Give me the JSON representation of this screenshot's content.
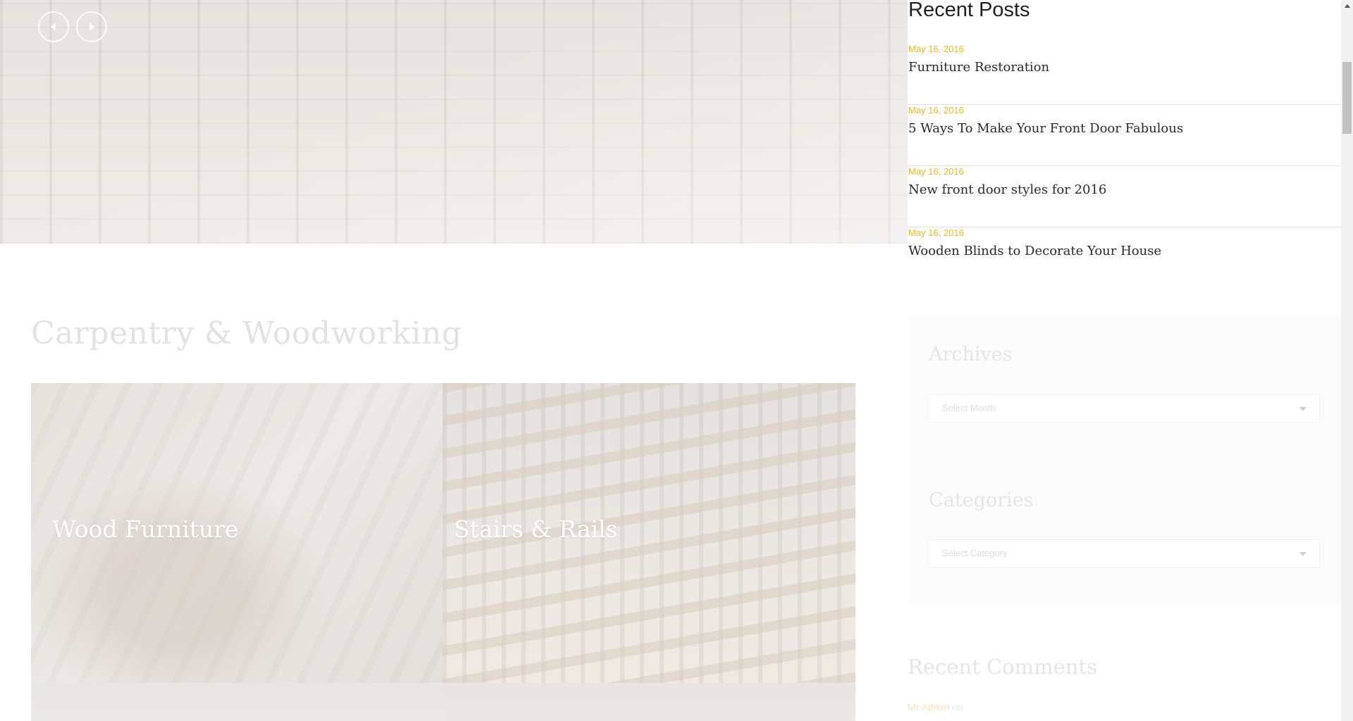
{
  "slider": {
    "prev_icon": "arrow-left-icon",
    "next_icon": "arrow-right-icon"
  },
  "main": {
    "section_title": "Carpentry & Woodworking",
    "tiles": [
      {
        "label": "Wood Furniture"
      },
      {
        "label": "Stairs & Rails"
      }
    ]
  },
  "sidebar": {
    "recent_posts": {
      "title": "Recent Posts",
      "posts": [
        {
          "date": "May 16, 2016",
          "title": "Furniture Restoration"
        },
        {
          "date": "May 16, 2016",
          "title": "5 Ways To Make Your Front Door Fabulous"
        },
        {
          "date": "May 16, 2016",
          "title": "New front door styles for 2016"
        },
        {
          "date": "May 16, 2016",
          "title": "Wooden Blinds to Decorate Your House"
        }
      ]
    },
    "archives": {
      "title": "Archives",
      "select_value": "Select Month"
    },
    "categories": {
      "title": "Categories",
      "select_value": "Select Category"
    },
    "recent_comments": {
      "title": "Recent Comments",
      "author": "Mr Admin",
      "suffix": "on"
    }
  },
  "colors": {
    "accent": "#f2b81c",
    "heading": "#222222",
    "faded": "#e5e5e5"
  }
}
